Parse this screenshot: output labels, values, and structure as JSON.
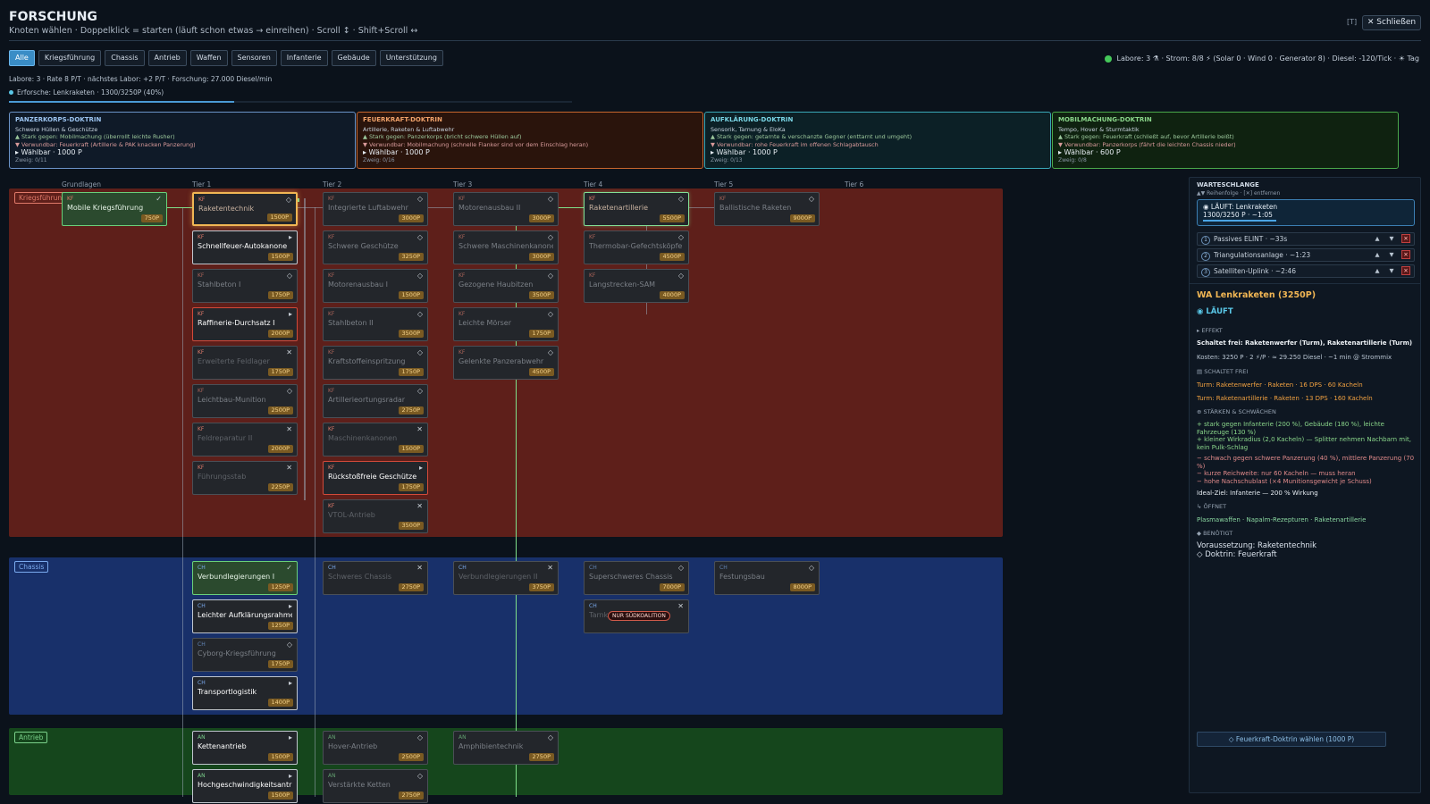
{
  "header": {
    "title": "FORSCHUNG",
    "subtitle": "Knoten wählen · Doppelklick = starten (läuft schon etwas → einreihen) · Scroll ↕ · Shift+Scroll ↔",
    "kbd_hint": "[T]",
    "close_label": "✕ Schließen"
  },
  "tabs": [
    "Alle",
    "Kriegsführung",
    "Chassis",
    "Antrieb",
    "Waffen",
    "Sensoren",
    "Infanterie",
    "Gebäude",
    "Unterstützung"
  ],
  "status": {
    "text": "Labore: 3 ⚗ · Strom: 8/8 ⚡ (Solar 0 · Wind 0 · Generator 8) · Diesel: -120/Tick · ☀ Tag",
    "color": "#45c85a"
  },
  "stats": "Labore: 3 · Rate 8 P/T · nächstes Labor: +2 P/T · Forschung: 27.000 Diesel/min",
  "progress": {
    "text": "Erforsche: Lenkraketen · 1300/3250P (40%)",
    "fraction": 0.4
  },
  "doctrines": [
    {
      "title": "PANZERKORPS-DOKTRIN",
      "desc": "Schwere Hüllen & Geschütze",
      "strong": "▲ Stark gegen: Mobilmachung (überrollt leichte Rusher)",
      "weak": "▼ Verwundbar: Feuerkraft (Artillerie & PAK knacken Panzerung)",
      "choose": "▸ Wählbar · 1000 P",
      "branch": "Zweig: 0/11",
      "color": "#6b93c8",
      "bg": "#0f1a28",
      "tcolor": "#9cc4f0"
    },
    {
      "title": "FEUERKRAFT-DOKTRIN",
      "desc": "Artillerie, Raketen & Luftabwehr",
      "strong": "▲ Stark gegen: Panzerkorps (bricht schwere Hüllen auf)",
      "weak": "▼ Verwundbar: Mobilmachung (schnelle Flanker sind vor dem Einschlag heran)",
      "choose": "▸ Wählbar · 1000 P",
      "branch": "Zweig: 0/16",
      "color": "#c8662e",
      "bg": "#2a140c",
      "tcolor": "#f0a26a"
    },
    {
      "title": "AUFKLÄRUNG-DOKTRIN",
      "desc": "Sensorik, Tarnung & EloKa",
      "strong": "▲ Stark gegen: getarnte & verschanzte Gegner (enttarnt und umgeht)",
      "weak": "▼ Verwundbar: rohe Feuerkraft im offenen Schlagabtausch",
      "choose": "▸ Wählbar · 1000 P",
      "branch": "Zweig: 0/13",
      "color": "#3aa8b8",
      "bg": "#0c2026",
      "tcolor": "#7ad6e6"
    },
    {
      "title": "MOBILMACHUNG-DOKTRIN",
      "desc": "Tempo, Hover & Sturmtaktik",
      "strong": "▲ Stark gegen: Feuerkraft (schließt auf, bevor Artillerie beißt)",
      "weak": "▼ Verwundbar: Panzerkorps (fährt die leichten Chassis nieder)",
      "choose": "▸ Wählbar · 600 P",
      "branch": "Zweig: 0/8",
      "color": "#4aa84a",
      "bg": "#0f2210",
      "tcolor": "#8ad68a"
    }
  ],
  "tiers": [
    "Grundlagen",
    "Tier 1",
    "Tier 2",
    "Tier 3",
    "Tier 4",
    "Tier 5",
    "Tier 6"
  ],
  "regions": [
    {
      "label": "Kriegsführung",
      "color": "#5e1f1a",
      "lcolor": "#e07a6a"
    },
    {
      "label": "Chassis",
      "color": "#18306a",
      "lcolor": "#7aaaee"
    },
    {
      "label": "Antrieb",
      "color": "#15461c",
      "lcolor": "#7ad08a"
    }
  ],
  "nodes": [
    {
      "cat": "KF",
      "name": "Mobile Kriegsführung",
      "cost": "750P",
      "icon": "✓",
      "state": "done",
      "tier": 0,
      "row": 0,
      "reg": 0
    },
    {
      "cat": "KF",
      "name": "Raketentechnik",
      "cost": "1500P",
      "icon": "◇",
      "state": "sel",
      "tier": 1,
      "row": 0,
      "reg": 0
    },
    {
      "cat": "KF",
      "name": "Schnellfeuer-Autokanone",
      "cost": "1500P",
      "icon": "▸",
      "state": "avail",
      "tier": 1,
      "row": 1,
      "reg": 0
    },
    {
      "cat": "KF",
      "name": "Stahlbeton I",
      "cost": "1750P",
      "icon": "◇",
      "state": "lk",
      "tier": 1,
      "row": 2,
      "reg": 0
    },
    {
      "cat": "KF",
      "name": "Raffinerie-Durchsatz I",
      "cost": "2000P",
      "icon": "▸",
      "state": "rd",
      "tier": 1,
      "row": 3,
      "reg": 0
    },
    {
      "cat": "KF",
      "name": "Erweiterte Feldlager",
      "cost": "1750P",
      "icon": "✕",
      "state": "fd",
      "tier": 1,
      "row": 4,
      "reg": 0
    },
    {
      "cat": "KF",
      "name": "Leichtbau-Munition",
      "cost": "2500P",
      "icon": "◇",
      "state": "lk",
      "tier": 1,
      "row": 5,
      "reg": 0
    },
    {
      "cat": "KF",
      "name": "Feldreparatur II",
      "cost": "2000P",
      "icon": "✕",
      "state": "fd",
      "tier": 1,
      "row": 6,
      "reg": 0
    },
    {
      "cat": "KF",
      "name": "Führungsstab",
      "cost": "2250P",
      "icon": "✕",
      "state": "fd",
      "tier": 1,
      "row": 7,
      "reg": 0
    },
    {
      "cat": "KF",
      "name": "Integrierte Luftabwehr",
      "cost": "3000P",
      "icon": "◇",
      "state": "lk",
      "tier": 2,
      "row": 0,
      "reg": 0
    },
    {
      "cat": "KF",
      "name": "Schwere Geschütze",
      "cost": "3250P",
      "icon": "◇",
      "state": "lk",
      "tier": 2,
      "row": 1,
      "reg": 0
    },
    {
      "cat": "KF",
      "name": "Motorenausbau I",
      "cost": "1500P",
      "icon": "◇",
      "state": "lk",
      "tier": 2,
      "row": 2,
      "reg": 0
    },
    {
      "cat": "KF",
      "name": "Stahlbeton II",
      "cost": "3500P",
      "icon": "◇",
      "state": "lk",
      "tier": 2,
      "row": 3,
      "reg": 0
    },
    {
      "cat": "KF",
      "name": "Kraftstoffeinspritzung",
      "cost": "1750P",
      "icon": "◇",
      "state": "lk",
      "tier": 2,
      "row": 4,
      "reg": 0
    },
    {
      "cat": "KF",
      "name": "Artillerieortungsradar",
      "cost": "2750P",
      "icon": "◇",
      "state": "lk",
      "tier": 2,
      "row": 5,
      "reg": 0
    },
    {
      "cat": "KF",
      "name": "Maschinenkanonen",
      "cost": "1500P",
      "icon": "✕",
      "state": "fd",
      "tier": 2,
      "row": 6,
      "reg": 0
    },
    {
      "cat": "KF",
      "name": "Rückstoßfreie Geschütze",
      "cost": "1750P",
      "icon": "▸",
      "state": "rd",
      "tier": 2,
      "row": 7,
      "reg": 0
    },
    {
      "cat": "KF",
      "name": "VTOL-Antrieb",
      "cost": "3500P",
      "icon": "✕",
      "state": "fd",
      "tier": 2,
      "row": 8,
      "reg": 0
    },
    {
      "cat": "KF",
      "name": "Motorenausbau II",
      "cost": "3000P",
      "icon": "◇",
      "state": "lk",
      "tier": 3,
      "row": 0,
      "reg": 0
    },
    {
      "cat": "KF",
      "name": "Schwere Maschinenkanone",
      "cost": "3000P",
      "icon": "◇",
      "state": "lk",
      "tier": 3,
      "row": 1,
      "reg": 0
    },
    {
      "cat": "KF",
      "name": "Gezogene Haubitzen",
      "cost": "3500P",
      "icon": "◇",
      "state": "lk",
      "tier": 3,
      "row": 2,
      "reg": 0
    },
    {
      "cat": "KF",
      "name": "Leichte Mörser",
      "cost": "1750P",
      "icon": "◇",
      "state": "lk",
      "tier": 3,
      "row": 3,
      "reg": 0
    },
    {
      "cat": "KF",
      "name": "Gelenkte Panzerabwehr",
      "cost": "4500P",
      "icon": "◇",
      "state": "lk",
      "tier": 3,
      "row": 4,
      "reg": 0
    },
    {
      "cat": "KF",
      "name": "Raketenartillerie",
      "cost": "5500P",
      "icon": "◇",
      "state": "tk",
      "tier": 4,
      "row": 0,
      "reg": 0
    },
    {
      "cat": "KF",
      "name": "Thermobar-Gefechtsköpfe",
      "cost": "4500P",
      "icon": "◇",
      "state": "lk",
      "tier": 4,
      "row": 1,
      "reg": 0
    },
    {
      "cat": "KF",
      "name": "Langstrecken-SAM",
      "cost": "4000P",
      "icon": "◇",
      "state": "lk",
      "tier": 4,
      "row": 2,
      "reg": 0
    },
    {
      "cat": "KF",
      "name": "Ballistische Raketen",
      "cost": "9000P",
      "icon": "◇",
      "state": "lk",
      "tier": 5,
      "row": 0,
      "reg": 0
    },
    {
      "cat": "CH",
      "name": "Verbundlegierungen I",
      "cost": "1250P",
      "icon": "✓",
      "state": "done",
      "tier": 1,
      "row": 0,
      "reg": 1
    },
    {
      "cat": "CH",
      "name": "Leichter Aufklärungsrahmen",
      "cost": "1250P",
      "icon": "▸",
      "state": "avail",
      "tier": 1,
      "row": 1,
      "reg": 1
    },
    {
      "cat": "CH",
      "name": "Cyborg-Kriegsführung",
      "cost": "1750P",
      "icon": "◇",
      "state": "lk",
      "tier": 1,
      "row": 2,
      "reg": 1
    },
    {
      "cat": "CH",
      "name": "Transportlogistik",
      "cost": "1400P",
      "icon": "▸",
      "state": "avail",
      "tier": 1,
      "row": 3,
      "reg": 1
    },
    {
      "cat": "CH",
      "name": "Schweres Chassis",
      "cost": "2750P",
      "icon": "✕",
      "state": "fd",
      "tier": 2,
      "row": 0,
      "reg": 1
    },
    {
      "cat": "CH",
      "name": "Verbundlegierungen II",
      "cost": "3750P",
      "icon": "✕",
      "state": "fd",
      "tier": 3,
      "row": 0,
      "reg": 1
    },
    {
      "cat": "CH",
      "name": "Superschweres Chassis",
      "cost": "7000P",
      "icon": "◇",
      "state": "lk",
      "tier": 4,
      "row": 0,
      "reg": 1
    },
    {
      "cat": "CH",
      "name": "Tarnk",
      "cost": "",
      "icon": "✕",
      "state": "fd",
      "tier": 4,
      "row": 1,
      "reg": 1,
      "badge": "NUR SÜDKOALITION"
    },
    {
      "cat": "CH",
      "name": "Festungsbau",
      "cost": "8000P",
      "icon": "◇",
      "state": "lk",
      "tier": 5,
      "row": 0,
      "reg": 1
    },
    {
      "cat": "AN",
      "name": "Kettenantrieb",
      "cost": "1500P",
      "icon": "▸",
      "state": "avail",
      "tier": 1,
      "row": 0,
      "reg": 2
    },
    {
      "cat": "AN",
      "name": "Hochgeschwindigkeitsantrieb",
      "cost": "1500P",
      "icon": "▸",
      "state": "avail",
      "tier": 1,
      "row": 1,
      "reg": 2
    },
    {
      "cat": "AN",
      "name": "Hover-Antrieb",
      "cost": "2500P",
      "icon": "◇",
      "state": "lk",
      "tier": 2,
      "row": 0,
      "reg": 2
    },
    {
      "cat": "AN",
      "name": "Verstärkte Ketten",
      "cost": "2750P",
      "icon": "◇",
      "state": "lk",
      "tier": 2,
      "row": 1,
      "reg": 2
    },
    {
      "cat": "AN",
      "name": "Amphibientechnik",
      "cost": "2750P",
      "icon": "◇",
      "state": "lk",
      "tier": 3,
      "row": 0,
      "reg": 2
    }
  ],
  "queue": {
    "title": "WARTESCHLANGE",
    "hint": "▲▼ Reihenfolge · [✕] entfernen",
    "running": "◉ LÄUFT: Lenkraketen",
    "running_sub": "1300/3250 P · ~1:05",
    "running_fraction": 0.4,
    "items": [
      {
        "n": "1",
        "label": "Passives ELINT · ~33s"
      },
      {
        "n": "2",
        "label": "Triangulationsanlage · ~1:23"
      },
      {
        "n": "3",
        "label": "Satelliten-Uplink · ~2:46"
      }
    ]
  },
  "details": {
    "title": "WA  Lenkraketen  (3250P)",
    "status": "◉ LÄUFT",
    "effect_h": "▸ EFFEKT",
    "effect": "Schaltet frei: Raketenwerfer (Turm), Raketenartillerie (Turm)",
    "costs": "Kosten: 3250 P · 2 ⚡/P · ≈ 29.250 Diesel · ~1 min @ Strommix",
    "unlocks_h": "▤ SCHALTET FREI",
    "unlock1": "Turm: Raketenwerfer · Raketen · 16 DPS · 60 Kacheln",
    "unlock2": "Turm: Raketenartillerie · Raketen · 13 DPS · 160 Kacheln",
    "sw_h": "⊕ STÄRKEN & SCHWÄCHEN",
    "strong": "+ stark gegen Infanterie (200 %), Gebäude (180 %), leichte Fahrzeuge (130 %)\n+ kleiner Wirkradius (2,0 Kacheln) — Splitter nehmen Nachbarn mit, kein Pulk-Schlag",
    "weak": "− schwach gegen schwere Panzerung (40 %), mittlere Panzerung (70 %)\n− kurze Reichweite: nur 60 Kacheln — muss heran\n− hohe Nachschublast (×4 Munitionsgewicht je Schuss)",
    "ideal": "Ideal-Ziel: Infanterie — 200 % Wirkung",
    "opens_h": "↳ ÖFFNET",
    "opens": "Plasmawaffen · Napalm-Rezepturen · Raketenartillerie",
    "req_h": "◆ BENÖTIGT",
    "req1": "Voraussetzung: Raketentechnik",
    "req2": "◇ Doktrin: Feuerkraft",
    "button": "◇ Feuerkraft-Doktrin wählen  (1000 P)"
  }
}
